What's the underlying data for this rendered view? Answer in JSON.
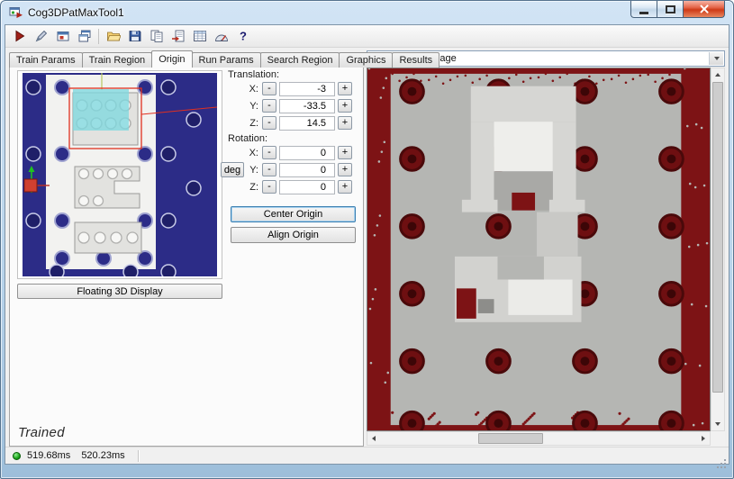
{
  "window": {
    "title": "Cog3DPatMaxTool1",
    "controls": [
      "minimize",
      "maximize",
      "close"
    ]
  },
  "toolbar": {
    "buttons": [
      "run",
      "electrode",
      "local-display",
      "float-display",
      "open-file",
      "save-file",
      "copy",
      "import",
      "results-grid",
      "calibration",
      "help"
    ]
  },
  "tabs": {
    "items": [
      "Train Params",
      "Train Region",
      "Origin",
      "Run Params",
      "Search Region",
      "Graphics",
      "Results"
    ],
    "active": "Origin"
  },
  "origin_page": {
    "translation_label": "Translation:",
    "rotation_label": "Rotation:",
    "deg_button_label": "deg",
    "x_label": "X:",
    "y_label": "Y:",
    "z_label": "Z:",
    "minus_label": "-",
    "plus_label": "+",
    "translation": {
      "x": "-3",
      "y": "-33.5",
      "z": "14.5"
    },
    "rotation": {
      "x": "0",
      "y": "0",
      "z": "0"
    },
    "center_origin_button": "Center Origin",
    "align_origin_button": "Align Origin",
    "floating_display_button": "Floating 3D Display",
    "train_state": "Trained"
  },
  "image_panel": {
    "selected_image": "Current.InputImage"
  },
  "status_bar": {
    "time_1": "519.68ms",
    "time_2": "520.23ms"
  },
  "colors": {
    "display_background": "#2c2c87",
    "image_background": "#7d1315",
    "image_foreground_gray": "#b5b6b3",
    "highlight_cyan": "#7fd8df",
    "highlight_red": "#e03020",
    "status_led_green": "#18a318"
  }
}
